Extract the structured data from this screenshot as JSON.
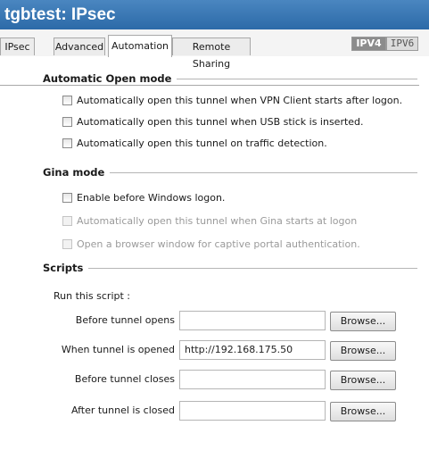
{
  "window": {
    "title": "tgbtest: IPsec"
  },
  "tabs": [
    {
      "label": "IPsec"
    },
    {
      "label": "Advanced"
    },
    {
      "label": "Automation"
    },
    {
      "label": "Remote Sharing"
    }
  ],
  "ip_toggle": {
    "ipv4": "IPV4",
    "ipv6": "IPV6",
    "selected": "IPV4"
  },
  "automatic_open": {
    "title": "Automatic Open mode",
    "options": [
      {
        "label": "Automatically open this tunnel when VPN Client starts after logon.",
        "checked": false,
        "enabled": true
      },
      {
        "label": "Automatically open this tunnel when USB stick is inserted.",
        "checked": false,
        "enabled": true
      },
      {
        "label": "Automatically open this tunnel on traffic detection.",
        "checked": false,
        "enabled": true
      }
    ]
  },
  "gina": {
    "title": "Gina mode",
    "options": [
      {
        "label": "Enable before Windows logon.",
        "checked": false,
        "enabled": true
      },
      {
        "label": "Automatically open this tunnel when Gina starts at logon",
        "checked": false,
        "enabled": false
      },
      {
        "label": "Open a browser window for captive portal authentication.",
        "checked": false,
        "enabled": false
      }
    ]
  },
  "scripts": {
    "title": "Scripts",
    "run_label": "Run this script :",
    "rows": [
      {
        "label": "Before tunnel opens",
        "value": "",
        "browse": "Browse..."
      },
      {
        "label": "When tunnel is opened",
        "value": "http://192.168.175.50",
        "browse": "Browse..."
      },
      {
        "label": "Before tunnel closes",
        "value": "",
        "browse": "Browse..."
      },
      {
        "label": "After tunnel is closed",
        "value": "",
        "browse": "Browse..."
      }
    ]
  }
}
